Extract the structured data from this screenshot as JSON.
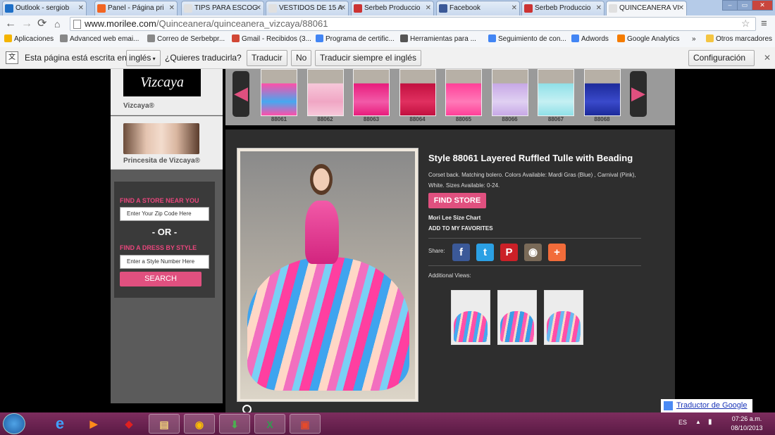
{
  "tabs": [
    {
      "label": "Outlook - sergiob",
      "color": "#1e6fc7"
    },
    {
      "label": "Panel - Página pri",
      "color": "#f26522"
    },
    {
      "label": "TIPS PARA ESCOG",
      "color": "#e0e0e0"
    },
    {
      "label": "VESTIDOS DE 15 A",
      "color": "#e0e0e0"
    },
    {
      "label": "Serbeb Produccio",
      "color": "#cc3333"
    },
    {
      "label": "Facebook",
      "color": "#3b5998"
    },
    {
      "label": "Serbeb Produccio",
      "color": "#cc3333"
    },
    {
      "label": "QUINCEANERA VI",
      "color": "#e0e0e0"
    }
  ],
  "url": {
    "domain": "www.morilee.com",
    "path": "/Quinceanera/quinceanera_vizcaya/88061"
  },
  "bookmarks": [
    {
      "label": "Aplicaciones",
      "color": "#f4b400"
    },
    {
      "label": "Advanced web emai...",
      "color": "#888888"
    },
    {
      "label": "Correo de Serbebpr...",
      "color": "#888888"
    },
    {
      "label": "Gmail - Recibidos (3...",
      "color": "#d14836"
    },
    {
      "label": "Programa de certific...",
      "color": "#4285f4"
    },
    {
      "label": "Herramientas para ...",
      "color": "#555555"
    },
    {
      "label": "Seguimiento de con...",
      "color": "#4285f4"
    },
    {
      "label": "Adwords",
      "color": "#4285f4"
    },
    {
      "label": "Google Analytics",
      "color": "#f57c00"
    },
    {
      "label": "»",
      "color": ""
    },
    {
      "label": "Otros marcadores",
      "color": "#f4c542"
    }
  ],
  "translate": {
    "prompt": "Esta página está escrita en",
    "language": "inglés",
    "question": "¿Quieres traducirla?",
    "translate_btn": "Traducir",
    "no_btn": "No",
    "always_btn": "Traducir siempre el inglés",
    "config_btn": "Configuración"
  },
  "sidebar": {
    "logo_text": "Vizcaya",
    "brand1_label": "Vizcaya®",
    "brand2_label": "Princesita de Vizcaya®",
    "find_store_heading": "FIND A STORE NEAR YOU",
    "zip_placeholder": "Enter Your Zip Code Here",
    "or_text": "- OR -",
    "find_dress_heading": "FIND A DRESS BY STYLE",
    "style_placeholder": "Enter a Style Number Here",
    "search_btn": "SEARCH"
  },
  "carousel": {
    "items": [
      {
        "label": "88061",
        "c1": "#ff4fa8",
        "c2": "#46a8f0"
      },
      {
        "label": "88062",
        "c1": "#f7c8da",
        "c2": "#f0a6c4"
      },
      {
        "label": "88063",
        "c1": "#e81c7c",
        "c2": "#f25aa8"
      },
      {
        "label": "88064",
        "c1": "#c2103f",
        "c2": "#e03060"
      },
      {
        "label": "88065",
        "c1": "#ff3f98",
        "c2": "#ff7ab8"
      },
      {
        "label": "88066",
        "c1": "#c7a8e6",
        "c2": "#e0d0f2"
      },
      {
        "label": "88067",
        "c1": "#8fe0e8",
        "c2": "#c5f0f3"
      },
      {
        "label": "88068",
        "c1": "#1c2a9a",
        "c2": "#3a4acb"
      }
    ]
  },
  "product": {
    "title": "Style 88061 Layered Ruffled Tulle with Beading",
    "description": "Corset back. Matching bolero. Colors Available: Mardi Gras (Blue) , Carnival (Pink), White. Sizes Available: 0-24.",
    "find_store_btn": "FIND STORE",
    "size_chart": "Mori Lee Size Chart",
    "favorites": "ADD TO MY FAVORITES",
    "share_label": "Share:",
    "social": [
      {
        "name": "facebook",
        "glyph": "f",
        "color": "#3b5998"
      },
      {
        "name": "twitter",
        "glyph": "t",
        "color": "#2ba0e4"
      },
      {
        "name": "pinterest",
        "glyph": "P",
        "color": "#cb2027"
      },
      {
        "name": "instagram",
        "glyph": "◉",
        "color": "#7a6a58"
      },
      {
        "name": "more",
        "glyph": "+",
        "color": "#f26c3a"
      }
    ],
    "additional_label": "Additional Views:",
    "additional_views": [
      {
        "c1": "#ff4fa8",
        "c2": "#46a8f0"
      },
      {
        "c1": "#3a9ee8",
        "c2": "#ff5ab0"
      },
      {
        "c1": "#ff4fa8",
        "c2": "#6ab8f2"
      }
    ]
  },
  "google_translate": "Traductor de Google",
  "taskbar": {
    "lang": "ES",
    "time": "07:26 a.m.",
    "date": "08/10/2013"
  }
}
